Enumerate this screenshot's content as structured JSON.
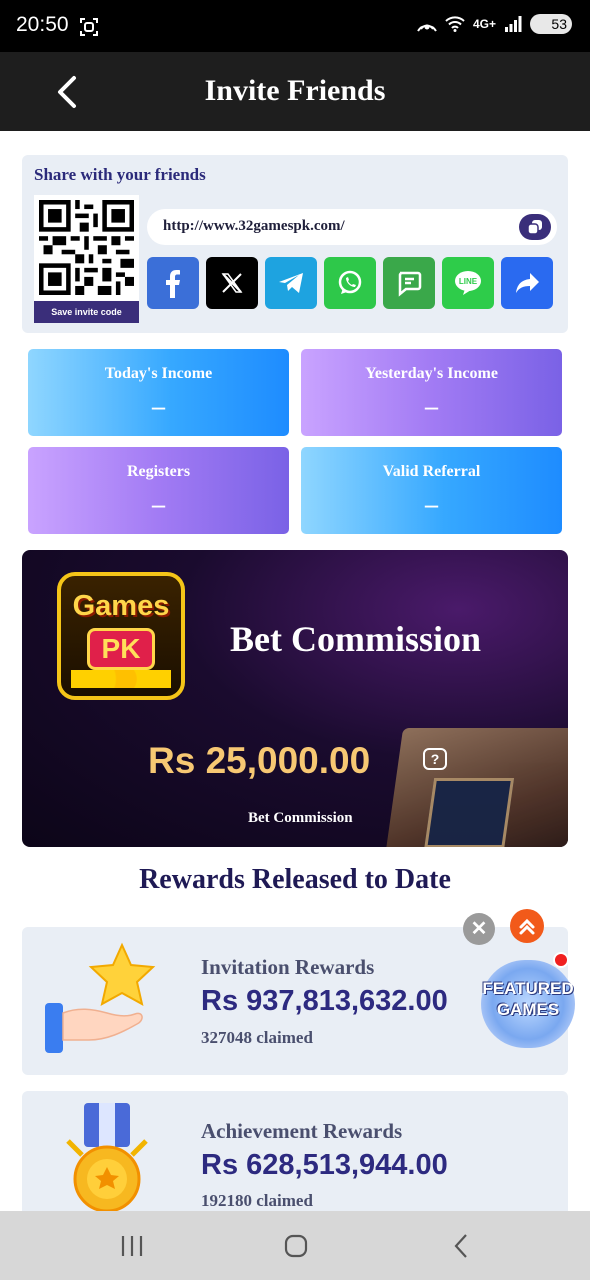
{
  "status_bar": {
    "time": "20:50",
    "network": "4G+",
    "battery": "53"
  },
  "header": {
    "title": "Invite Friends",
    "back_icon": "chevron-left-icon"
  },
  "share": {
    "title": "Share with your friends",
    "save_label": "Save invite code",
    "url": "http://www.32gamespk.com/",
    "socials": [
      {
        "name": "facebook-icon",
        "color": "#3b6fd8"
      },
      {
        "name": "x-icon",
        "color": "#000000"
      },
      {
        "name": "telegram-icon",
        "color": "#1ea3e0"
      },
      {
        "name": "whatsapp-icon",
        "color": "#2ec84a"
      },
      {
        "name": "sms-icon",
        "color": "#3aa84a"
      },
      {
        "name": "line-icon",
        "color": "#2ecc4a"
      },
      {
        "name": "share-icon",
        "color": "#2a6af0"
      }
    ]
  },
  "stats": {
    "today_income": {
      "label": "Today's Income",
      "value": "–"
    },
    "yesterday_income": {
      "label": "Yesterday's Income",
      "value": "–"
    },
    "registers": {
      "label": "Registers",
      "value": "–"
    },
    "valid_referral": {
      "label": "Valid Referral",
      "value": "–"
    }
  },
  "commission": {
    "logo_top": "Games",
    "logo_bottom": "PK",
    "title": "Bet Commission",
    "amount": "Rs  25,000.00",
    "help": "?",
    "subtitle": "Bet Commission"
  },
  "rewards_title": "Rewards Released to Date",
  "rewards": [
    {
      "title": "Invitation Rewards",
      "amount": "Rs  937,813,632.00",
      "claimed": "327048 claimed"
    },
    {
      "title": "Achievement Rewards",
      "amount": "Rs  628,513,944.00",
      "claimed": "192180 claimed"
    }
  ],
  "floating": {
    "close": "✕",
    "featured_line1": "FEATURED",
    "featured_line2": "GAMES"
  }
}
